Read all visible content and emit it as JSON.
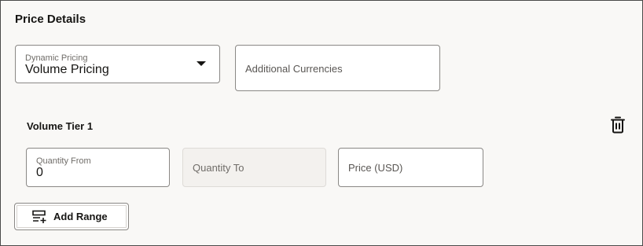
{
  "section": {
    "title": "Price Details"
  },
  "dynamic_pricing": {
    "label": "Dynamic Pricing",
    "value": "Volume Pricing"
  },
  "additional_currencies": {
    "label": "Additional Currencies"
  },
  "tier": {
    "title": "Volume Tier 1",
    "quantity_from": {
      "label": "Quantity From",
      "value": "0"
    },
    "quantity_to": {
      "label": "Quantity To"
    },
    "price": {
      "label": "Price (USD)"
    }
  },
  "add_range": {
    "label": "Add Range"
  },
  "icons": {
    "delete": "trash-icon",
    "add_range": "add-list-icon",
    "dropdown": "caret-down-icon"
  }
}
